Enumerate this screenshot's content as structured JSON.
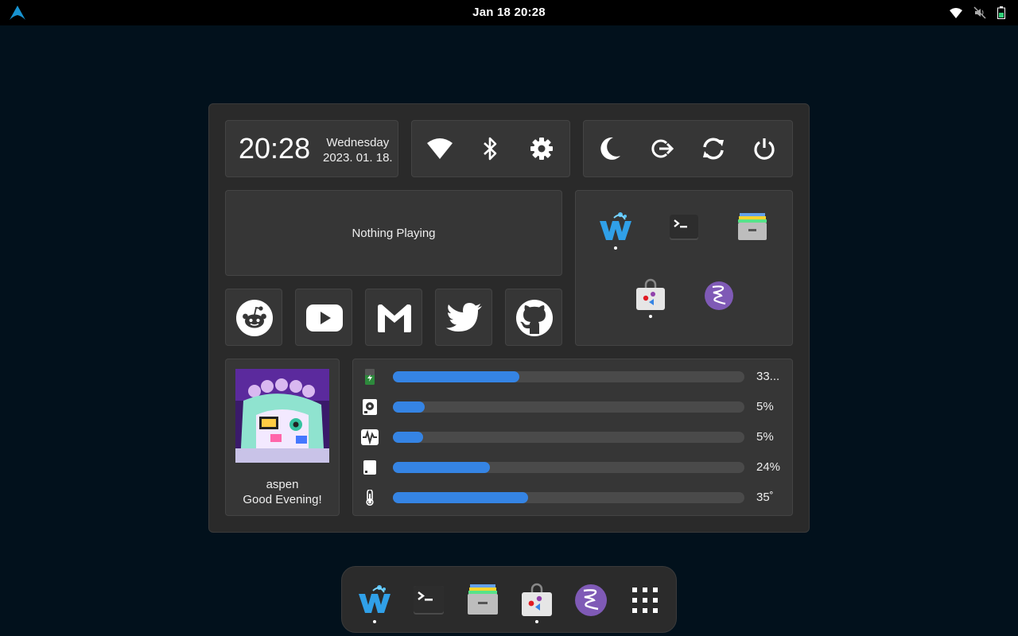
{
  "topbar": {
    "activities_icon": "arch-icon",
    "datetime": "Jan 18  20:28",
    "tray_icons": [
      "wifi-icon",
      "speaker-muted-icon",
      "battery-icon"
    ]
  },
  "clock_card": {
    "time": "20:28",
    "weekday": "Wednesday",
    "date": "2023. 01. 18."
  },
  "quick_toggles": [
    {
      "icon": "wifi-icon"
    },
    {
      "icon": "bluetooth-icon"
    },
    {
      "icon": "gear-icon"
    }
  ],
  "power_actions": [
    {
      "icon": "moon-icon"
    },
    {
      "icon": "logout-icon"
    },
    {
      "icon": "restart-icon"
    },
    {
      "icon": "power-icon"
    }
  ],
  "media": {
    "status": "Nothing Playing"
  },
  "links": [
    {
      "icon": "reddit-icon"
    },
    {
      "icon": "youtube-icon"
    },
    {
      "icon": "gmail-icon"
    },
    {
      "icon": "twitter-icon"
    },
    {
      "icon": "github-icon"
    }
  ],
  "apps": [
    {
      "icon": "web-browser-icon",
      "running": true
    },
    {
      "icon": "terminal-icon",
      "running": false
    },
    {
      "icon": "files-icon",
      "running": false
    },
    {
      "icon": "software-store-icon",
      "running": true
    },
    {
      "icon": "emacs-icon",
      "running": false
    }
  ],
  "user": {
    "username": "aspen",
    "greeting": "Good Evening!"
  },
  "system_stats": [
    {
      "icon": "battery-icon",
      "value": "33...",
      "fraction": 0.36
    },
    {
      "icon": "disk-icon",
      "value": "5%",
      "fraction": 0.09
    },
    {
      "icon": "cpu-activity-icon",
      "value": "5%",
      "fraction": 0.085
    },
    {
      "icon": "memory-icon",
      "value": "24%",
      "fraction": 0.275
    },
    {
      "icon": "thermometer-icon",
      "value": "35˚",
      "fraction": 0.385
    }
  ],
  "dock": [
    {
      "icon": "web-browser-icon",
      "running": true
    },
    {
      "icon": "terminal-icon",
      "running": false
    },
    {
      "icon": "files-icon",
      "running": false
    },
    {
      "icon": "software-store-icon",
      "running": true
    },
    {
      "icon": "emacs-icon",
      "running": false
    },
    {
      "icon": "app-grid-icon",
      "running": false
    }
  ],
  "colors": {
    "accent": "#3584e4",
    "background": "#02111c",
    "panel": "#2a2a2a",
    "card": "#363636"
  }
}
